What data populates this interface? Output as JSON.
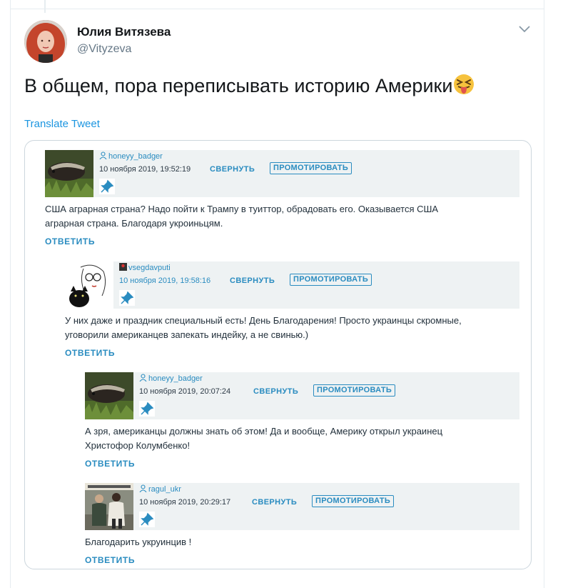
{
  "tweet": {
    "display_name": "Юлия Витязева",
    "handle": "@Vityzeva",
    "text": "В общем, пора переписывать историю Америки",
    "emoji_icon": "squinting-face-with-tongue-icon",
    "translate_label": "Translate Tweet"
  },
  "thread": [
    {
      "user": "honeyy_badger",
      "date": "10 ноября 2019, 19:52:19",
      "collapse_label": "СВЕРНУТЬ",
      "promote_label": "ПРОМОТИРОВАТЬ",
      "text_lines": [
        "США аграрная страна? Надо пойти к Трампу в туиттор, обрадовать его. Оказывается США",
        "аграрная страна. Благодаря укроиньцям."
      ],
      "reply_label": "ОТВЕТИТЬ"
    },
    {
      "user": "vsegdavputi",
      "date": "10 ноября 2019, 19:58:16",
      "collapse_label": "СВЕРНУТЬ",
      "promote_label": "ПРОМОТИРОВАТЬ",
      "text_lines": [
        "У них даже и праздник специальный есть! День Благодарения! Просто украинцы скромные,",
        "уговорили американцев запекать индейку, а не свинью.)"
      ],
      "reply_label": "ОТВЕТИТЬ"
    },
    {
      "user": "honeyy_badger",
      "date": "10 ноября 2019, 20:07:24",
      "collapse_label": "СВЕРНУТЬ",
      "promote_label": "ПРОМОТИРОВАТЬ",
      "text_lines": [
        "А зря, американцы должны знать об этом! Да и вообще, Америку открыл украинец",
        "Христофор Колумбенко!"
      ],
      "reply_label": "ОТВЕТИТЬ"
    },
    {
      "user": "ragul_ukr",
      "date": "10 ноября 2019, 20:29:17",
      "collapse_label": "СВЕРНУТЬ",
      "promote_label": "ПРОМОТИРОВАТЬ",
      "text_lines": [
        "Благодарить укруинцив !"
      ],
      "reply_label": "ОТВЕТИТЬ"
    }
  ],
  "colors": {
    "twitter_blue": "#1b95e0",
    "comment_accent": "#2a8cc0",
    "comment_header_bg": "#eef2f3"
  }
}
